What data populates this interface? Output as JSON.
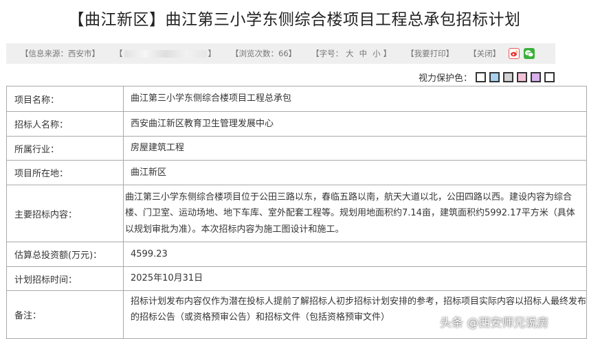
{
  "page_title": "【曲江新区】曲江第三小学东侧综合楼项目工程总承包招标计划",
  "infobar": {
    "source_label": "【信息来源：西安市】",
    "blurred_prefix": "【",
    "blurred_suffix": "】",
    "views_label": "【浏览次数：66】",
    "font_size_label": "【字号：",
    "size_large": "大",
    "size_medium": "中",
    "size_small": "小",
    "font_size_close": "】",
    "print_label": "【我要打印】",
    "close_label": "【关闭】"
  },
  "share": {
    "weibo_icon": "weibo-icon",
    "wechat_icon": "wechat-icon"
  },
  "eye_care": {
    "label": "视力保护色：",
    "swatches": [
      "#ffffff",
      "#a6d2f0",
      "#d2d2d2",
      "#f3c1d7",
      "#d8b0ec",
      "#ffffff"
    ]
  },
  "rows": [
    {
      "label": "项目名称：",
      "value": "曲江第三小学东侧综合楼项目工程总承包"
    },
    {
      "label": "招标人名称：",
      "value": "西安曲江新区教育卫生管理发展中心"
    },
    {
      "label": "所属行业：",
      "value": "房屋建筑工程"
    },
    {
      "label": "项目所在地：",
      "value": "曲江新区"
    },
    {
      "label": "主要招标内容：",
      "value": "曲江第三小学东侧综合楼项目位于公田三路以东，春临五路以南，航天大道以北，公田四路以西。建设内容为综合楼、门卫室、运动场地、地下车库、室外配套工程等。规划用地面积约7.14亩，建筑面积约5992.17平方米（具体以规划审批为准）。本次招标内容为施工图设计和施工。"
    },
    {
      "label": "估算总投资额(万元)：",
      "value": "4599.23"
    },
    {
      "label": "计划招标时间：",
      "value": "2025年10月31日"
    },
    {
      "label": "备注：",
      "value": "招标计划发布内容仅作为潜在投标人提前了解招标人初步招标计划安排的参考，招标项目实际内容以招标人最终发布的招标公告（或资格预审公告）和招标文件（包括资格预审文件）"
    }
  ],
  "watermark": "头条 @西安师兄说房"
}
